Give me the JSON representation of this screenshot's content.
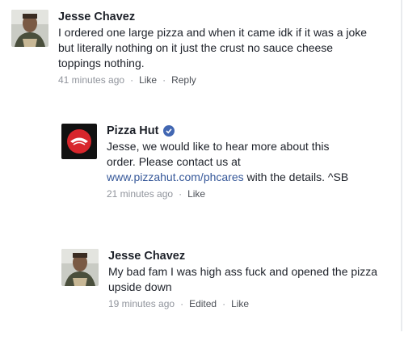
{
  "comments": [
    {
      "author": "Jesse Chavez",
      "text": "I ordered one large pizza and when it came idk if it was a joke but literally nothing on it just the crust no sauce cheese toppings nothing.",
      "time": "41 minutes ago",
      "actions": [
        "Like",
        "Reply"
      ]
    },
    {
      "author": "Pizza Hut",
      "text_before": "Jesse, we would like to hear more about this order. Please contact us at ",
      "link": "www.pizzahut.com/phcares",
      "text_after": " with the details. ^SB",
      "time": "21 minutes ago",
      "actions": [
        "Like"
      ]
    },
    {
      "author": "Jesse Chavez",
      "text": "My bad fam I was high ass fuck and opened the pizza upside down",
      "time": "19 minutes ago",
      "edited": "Edited",
      "actions": [
        "Like"
      ]
    }
  ],
  "colors": {
    "link": "#365899",
    "meta": "#90949c",
    "verified": "#4267b2",
    "pizzahut_red": "#d8262c"
  },
  "icons": [
    "avatar-photo",
    "pizza-hut-logo",
    "verified-badge-icon"
  ]
}
